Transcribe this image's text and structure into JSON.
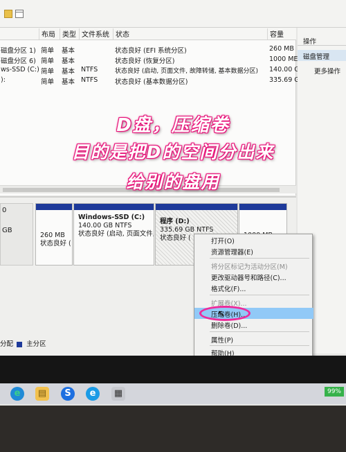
{
  "columns": [
    "布局",
    "类型",
    "文件系统",
    "状态",
    "容量"
  ],
  "volumes": [
    {
      "name": "磁盘分区 1)",
      "layout": "简单",
      "type": "基本",
      "fs": "",
      "status": "状态良好 (EFI 系统分区)",
      "capacity": "260 MB"
    },
    {
      "name": "磁盘分区 6)",
      "layout": "简单",
      "type": "基本",
      "fs": "",
      "status": "状态良好 (恢复分区)",
      "capacity": "1000 ME"
    },
    {
      "name": "ws-SSD (C:)",
      "layout": "简单",
      "type": "基本",
      "fs": "NTFS",
      "status": "状态良好 (启动, 页面文件, 故障转储, 基本数据分区)",
      "capacity": "140.00 G"
    },
    {
      "name": "):",
      "layout": "简单",
      "type": "基本",
      "fs": "NTFS",
      "status": "状态良好 (基本数据分区)",
      "capacity": "335.69 G"
    }
  ],
  "actions": {
    "header": "操作",
    "section": "磁盘管理",
    "more": "更多操作"
  },
  "disk": {
    "label_line1": "0",
    "label_line2": "GB",
    "partitions": [
      {
        "title": "",
        "size": "260 MB",
        "status": "状态良好 ("
      },
      {
        "title": "Windows-SSD (C:)",
        "size": "140.00 GB NTFS",
        "status": "状态良好 (启动, 页面文件,"
      },
      {
        "title": "程序 (D:)",
        "size": "335.69 GB NTFS",
        "status": "状态良好 ("
      },
      {
        "title": "",
        "size": "1000 MB",
        "status": ""
      }
    ],
    "legend": [
      "分配",
      "主分区"
    ]
  },
  "context_menu": [
    {
      "label": "打开(O)",
      "enabled": true
    },
    {
      "label": "资源管理器(E)",
      "enabled": true
    },
    {
      "label": "将分区标记为活动分区(M)",
      "enabled": false
    },
    {
      "label": "更改驱动器号和路径(C)...",
      "enabled": true
    },
    {
      "label": "格式化(F)...",
      "enabled": true
    },
    {
      "label": "扩展卷(X)...",
      "enabled": false
    },
    {
      "label": "压缩卷(H)...",
      "enabled": true,
      "highlighted": true
    },
    {
      "label": "删除卷(D)...",
      "enabled": true
    },
    {
      "label": "属性(P)",
      "enabled": true
    },
    {
      "label": "帮助(H)",
      "enabled": true
    }
  ],
  "caption": [
    "D盘，压缩卷",
    "目的是把D的空间分出来",
    "给别的盘用"
  ],
  "battery": "99%",
  "colors": {
    "caption_glow": "#e8147a",
    "highlight_ring": "#ee2b9b",
    "partition_bar": "#1e3a9a",
    "menu_highlight": "#91c9f7"
  }
}
